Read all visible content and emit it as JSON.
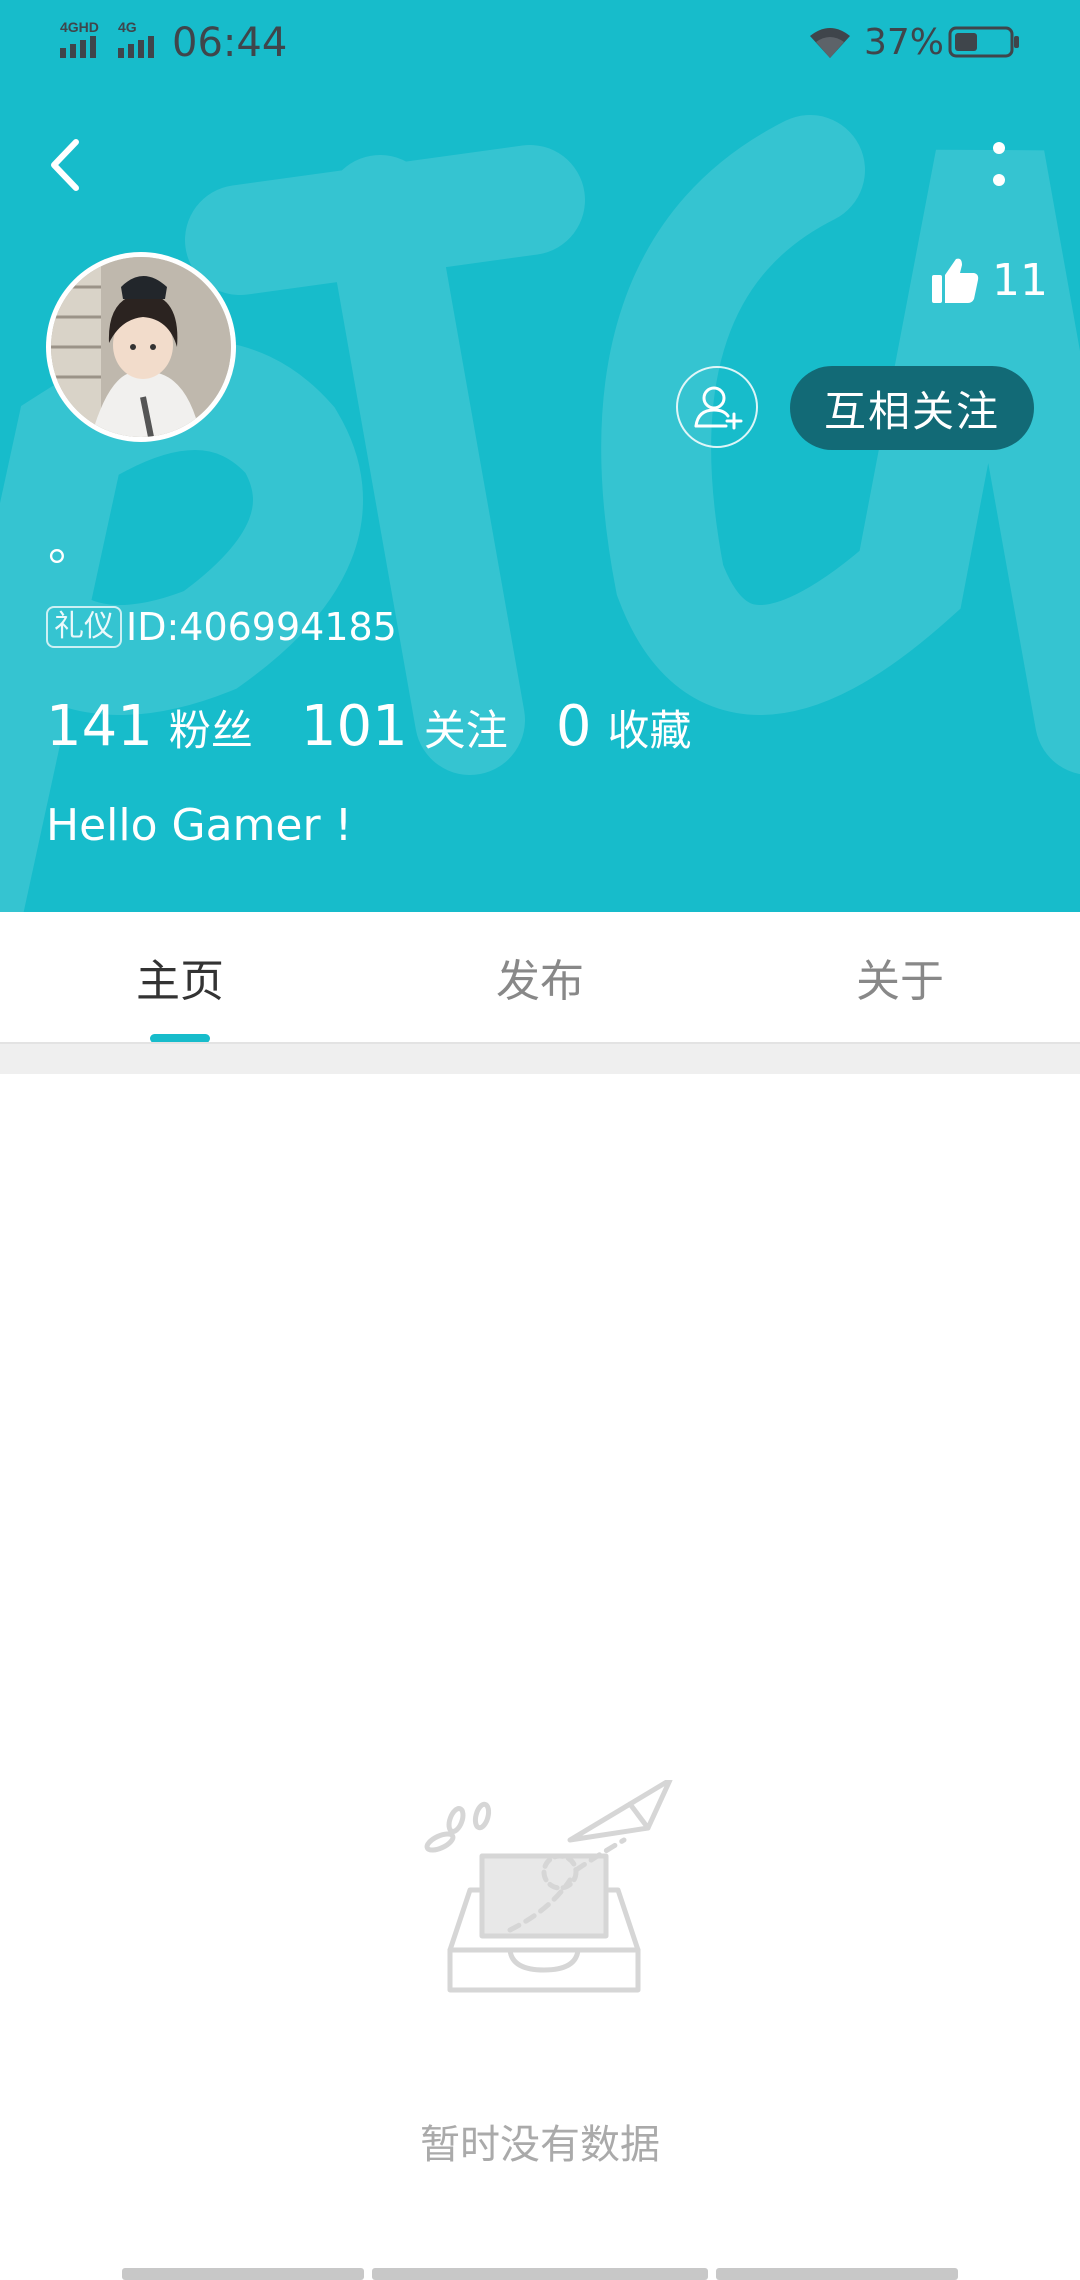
{
  "status_bar": {
    "network": "4GHD 4G",
    "time": "06:44",
    "battery": "37%",
    "icons": [
      "signal-icon",
      "wifi-icon",
      "battery-icon"
    ]
  },
  "nav": {
    "back_icon": "back-chevron-icon",
    "more_icon": "more-vertical-icon"
  },
  "profile": {
    "avatar_icon": "user-avatar",
    "likes": "11",
    "mutual_follow_label": "互相关注",
    "nickname": "。",
    "badge": "礼仪",
    "user_id": "ID:406994185",
    "stats": [
      {
        "num": "141",
        "label": "粉丝"
      },
      {
        "num": "101",
        "label": "关注"
      },
      {
        "num": "0",
        "label": "收藏"
      }
    ],
    "bio": "Hello Gamer !"
  },
  "tabs": [
    {
      "label": "主页",
      "active": true
    },
    {
      "label": "发布",
      "active": false
    },
    {
      "label": "关于",
      "active": false
    }
  ],
  "empty": {
    "text": "暂时没有数据",
    "icon": "empty-inbox-icon"
  },
  "colors": {
    "brand": "#17bccb",
    "button_dark": "#126a76",
    "muted_text": "#aaaaaa"
  }
}
